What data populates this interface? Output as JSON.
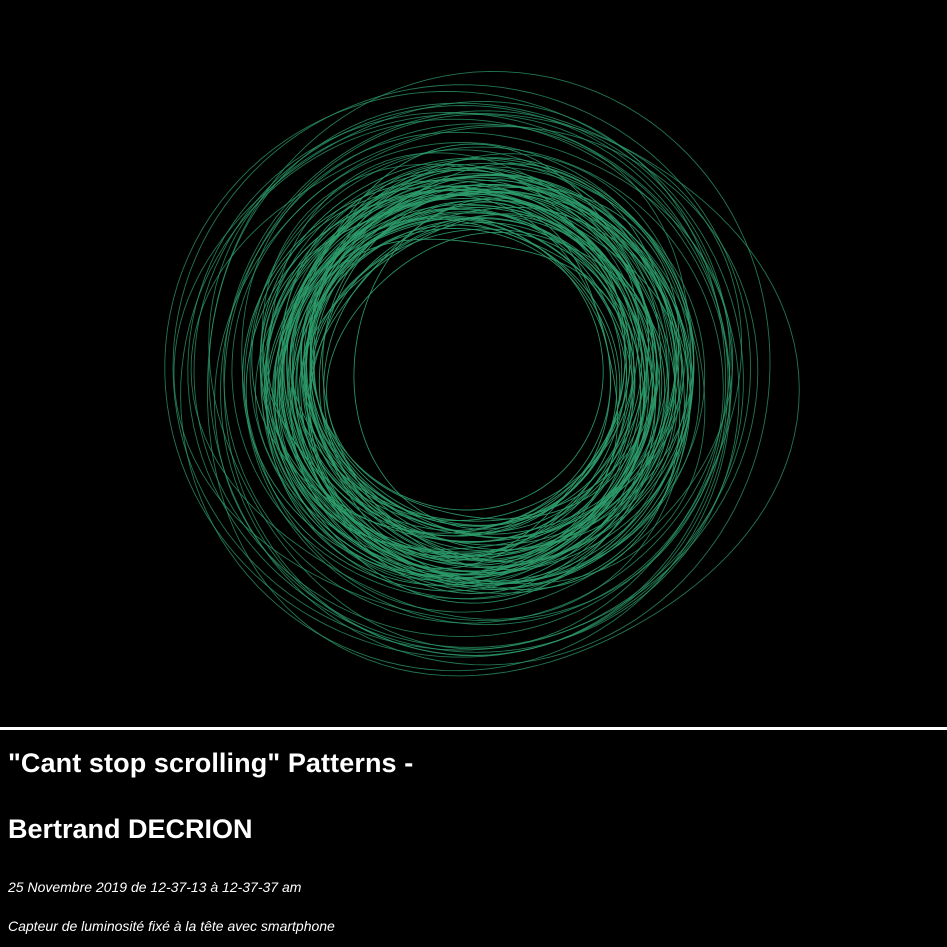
{
  "artwork": {
    "stroke_color": "#2e9d6c",
    "background_color": "#000000"
  },
  "caption_block": {
    "title": "\"Cant stop scrolling\" Patterns -",
    "author": "Bertrand DECRION",
    "date_line": "25 Novembre 2019 de 12-37-13 à 12-37-37 am",
    "description": "Capteur de luminosité fixé à la tête avec smartphone"
  }
}
